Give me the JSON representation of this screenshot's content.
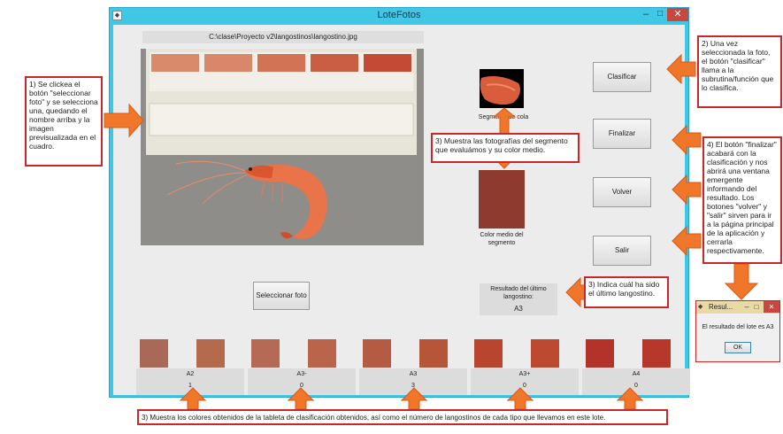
{
  "window": {
    "title": "LoteFotos",
    "min_glyph": "–",
    "max_glyph": "□",
    "close_glyph": "✕",
    "app_icon_glyph": "◆"
  },
  "path": "C:\\clase\\Proyecto v2\\langostinos\\langostino.jpg",
  "photo": {
    "card_swatches": [
      {
        "label": "A2",
        "color": "#d98a6a"
      },
      {
        "label": "A3-",
        "color": "#d8876a"
      },
      {
        "label": "A3",
        "color": "#d27355"
      },
      {
        "label": "A3+",
        "color": "#c95e44"
      },
      {
        "label": "A4",
        "color": "#c44a36"
      }
    ]
  },
  "segment": {
    "image_label": "Segmento de cola",
    "color_label": "Color medio del segmento",
    "mean_color": "#8e3a2e"
  },
  "result": {
    "label": "Resultado del último langostino:",
    "value": "A3"
  },
  "buttons": {
    "clasificar": "Clasificar",
    "finalizar": "Finalizar",
    "volver": "Volver",
    "salir": "Salir",
    "seleccionar": "Seleccionar foto"
  },
  "categories": [
    {
      "label": "A2",
      "count": "1",
      "colors": [
        "#a86a56",
        "#b36a4d"
      ]
    },
    {
      "label": "A3-",
      "count": "0",
      "colors": [
        "#b46a55",
        "#b9644b"
      ]
    },
    {
      "label": "A3",
      "count": "3",
      "colors": [
        "#b45c43",
        "#b65538"
      ]
    },
    {
      "label": "A3+",
      "count": "0",
      "colors": [
        "#b8462f",
        "#bb4a30"
      ]
    },
    {
      "label": "A4",
      "count": "0",
      "colors": [
        "#b3322a",
        "#b8372b"
      ]
    }
  ],
  "notes": {
    "n1": "1) Se clickea el botón \"seleccionar foto\" y se selecciona una, quedando el nombre arriba y la imagen previsualizada en el cuadro.",
    "n2": "2) Una vez seleccionada la foto, el botón \"clasificar\" llama a la subrutina/función que lo clasifica.",
    "n3a": "3) Muestra las fotografías del segmento que evaluámos y su color medio.",
    "n3b": "3) Indica cuál ha sido el último langostino.",
    "n3c": "3) Muestra los colores obtenidos de la tableta de clasificación obtenidos, así como el número de langostinos de cada tipo que llevamos en este lote.",
    "n4": "4) El botón \"finalizar\" acabará con la clasificación y nos abrirá una ventana emergente informando del resultado. Los botones \"volver\" y \"salir\" sirven para ir a la página principal de la aplicación y cerrarla respectivamente."
  },
  "popup": {
    "title": "Resul...",
    "message": "El resultado del lote es A3",
    "ok": "OK",
    "min_glyph": "–",
    "max_glyph": "□",
    "close_glyph": "✕"
  },
  "colors": {
    "accent": "#41c7e6",
    "annotation_border": "#c8282a",
    "arrow": "#f0762a"
  }
}
